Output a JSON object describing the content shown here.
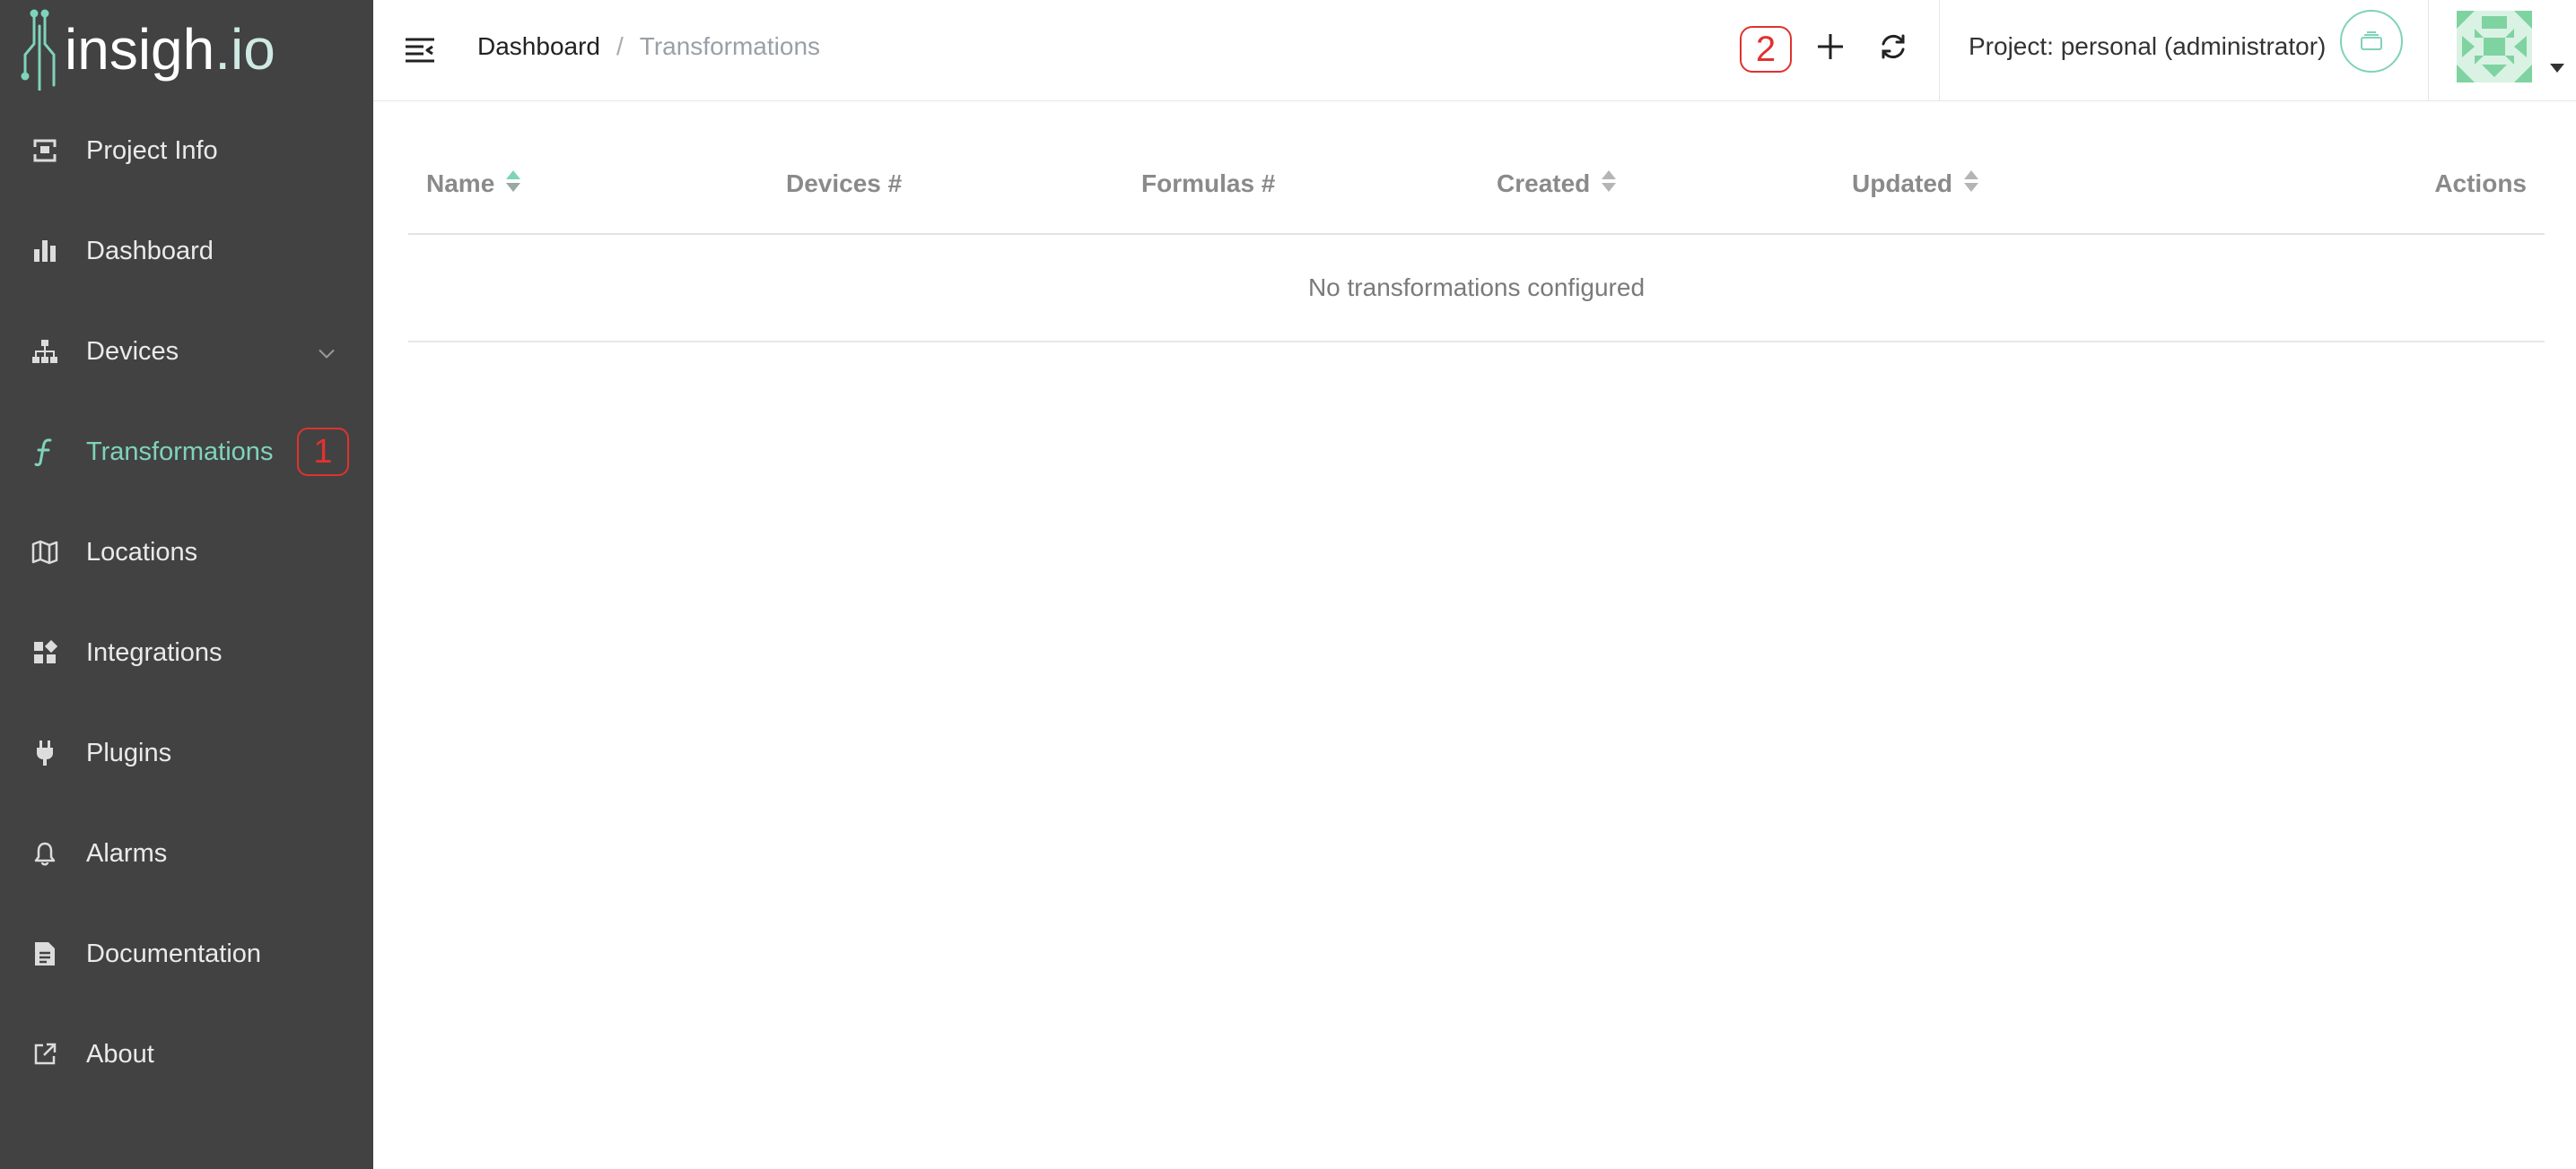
{
  "brand": {
    "logo_text": "insigh",
    "logo_suffix": ".io"
  },
  "sidebar": {
    "items": [
      {
        "label": "Project Info",
        "icon": "project-info-icon"
      },
      {
        "label": "Dashboard",
        "icon": "bar-chart-icon"
      },
      {
        "label": "Devices",
        "icon": "sitemap-icon",
        "expandable": true
      },
      {
        "label": "Transformations",
        "icon": "function-icon",
        "active": true,
        "annotation": "1"
      },
      {
        "label": "Locations",
        "icon": "map-icon"
      },
      {
        "label": "Integrations",
        "icon": "grid-icon"
      },
      {
        "label": "Plugins",
        "icon": "plug-icon"
      },
      {
        "label": "Alarms",
        "icon": "bell-icon"
      },
      {
        "label": "Documentation",
        "icon": "document-icon"
      },
      {
        "label": "About",
        "icon": "external-link-icon"
      }
    ]
  },
  "header": {
    "breadcrumb": {
      "home": "Dashboard",
      "separator": "/",
      "current": "Transformations"
    },
    "annotation": "2",
    "project_label": "Project: personal (administrator)"
  },
  "table": {
    "columns": [
      {
        "label": "Name",
        "sortable": true,
        "sort_active": true
      },
      {
        "label": "Devices #",
        "sortable": false
      },
      {
        "label": "Formulas #",
        "sortable": false
      },
      {
        "label": "Created",
        "sortable": true
      },
      {
        "label": "Updated",
        "sortable": true
      },
      {
        "label": "Actions",
        "sortable": false
      }
    ],
    "empty_message": "No transformations configured"
  },
  "colors": {
    "sidebar_bg": "#424242",
    "accent": "#7fd3bb",
    "annotation_red": "#e0322f",
    "header_text_gray": "#8a8a8a"
  }
}
